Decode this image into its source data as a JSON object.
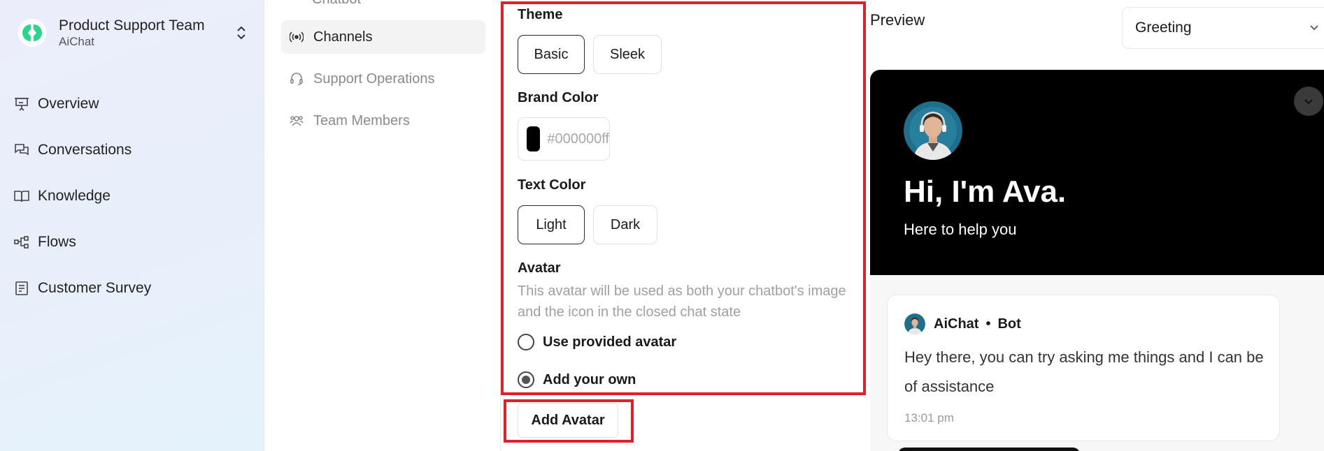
{
  "team": {
    "name": "Product Support Team",
    "sub": "AiChat"
  },
  "sidebar": {
    "items": [
      {
        "label": "Overview",
        "icon": "presentation-icon"
      },
      {
        "label": "Conversations",
        "icon": "chat-bubbles-icon"
      },
      {
        "label": "Knowledge",
        "icon": "book-open-icon"
      },
      {
        "label": "Flows",
        "icon": "flow-nodes-icon"
      },
      {
        "label": "Customer Survey",
        "icon": "survey-doc-icon"
      }
    ]
  },
  "subnav": {
    "cut_label": "Chatbot",
    "items": [
      {
        "label": "Channels",
        "icon": "broadcast-icon",
        "active": true
      },
      {
        "label": "Support Operations",
        "icon": "headset-icon",
        "active": false
      },
      {
        "label": "Team Members",
        "icon": "users-icon",
        "active": false
      }
    ]
  },
  "settings": {
    "theme": {
      "label": "Theme",
      "options": [
        "Basic",
        "Sleek"
      ],
      "selected": "Basic"
    },
    "brand_color": {
      "label": "Brand Color",
      "value": "#000000ff",
      "swatch": "#000000"
    },
    "text_color": {
      "label": "Text Color",
      "options": [
        "Light",
        "Dark"
      ],
      "selected": "Light"
    },
    "avatar": {
      "label": "Avatar",
      "description": "This avatar will be used as both your chatbot's image and the icon in the closed chat state",
      "options": [
        "Use provided avatar",
        "Add your own"
      ],
      "selected": "Add your own",
      "add_button": "Add Avatar"
    },
    "highlight_color": "#e0202a"
  },
  "preview": {
    "title": "Preview",
    "dropdown": {
      "value": "Greeting"
    },
    "greeting": "Hi, I'm Ava.",
    "greeting_sub": "Here to help you",
    "message": {
      "sender": "AiChat",
      "role": "Bot",
      "text": "Hey there, you can try asking me things and I can be of assistance",
      "time": "13:01 pm"
    }
  }
}
